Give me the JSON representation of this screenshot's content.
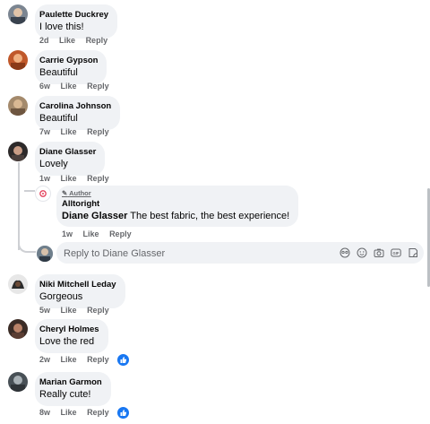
{
  "comments": [
    {
      "author": "Paulette Duckrey",
      "text": "I love this!",
      "time": "2d",
      "like": "Like",
      "reply": "Reply"
    },
    {
      "author": "Carrie Gypson",
      "text": "Beautiful",
      "time": "6w",
      "like": "Like",
      "reply": "Reply"
    },
    {
      "author": "Carolina Johnson",
      "text": "Beautiful",
      "time": "7w",
      "like": "Like",
      "reply": "Reply"
    },
    {
      "author": "Diane Glasser",
      "text": "Lovely",
      "time": "1w",
      "like": "Like",
      "reply": "Reply"
    },
    {
      "author": "Niki Mitchell Leday",
      "text": "Gorgeous",
      "time": "5w",
      "like": "Like",
      "reply": "Reply"
    },
    {
      "author": "Cheryl Holmes",
      "text": "Love the red",
      "time": "2w",
      "like": "Like",
      "reply": "Reply"
    },
    {
      "author": "Marian Garmon",
      "text": "Really cute!",
      "time": "8w",
      "like": "Like",
      "reply": "Reply"
    }
  ],
  "author_reply": {
    "badge": "Author",
    "author": "Alltoright",
    "mention": "Diane Glasser",
    "text": " The best fabric, the best experience!",
    "time": "1w",
    "like": "Like",
    "reply": "Reply"
  },
  "reply_box": {
    "placeholder": "Reply to Diane Glasser"
  },
  "colors": {
    "bubble": "#f0f2f5",
    "meta": "#65676b",
    "like_blue": "#1877f2",
    "author_red": "#e4415b"
  },
  "icons": [
    "pencil-icon",
    "like-thumb-icon",
    "avatar-mask-icon",
    "emoji-icon",
    "camera-icon",
    "gif-icon",
    "sticker-icon"
  ]
}
